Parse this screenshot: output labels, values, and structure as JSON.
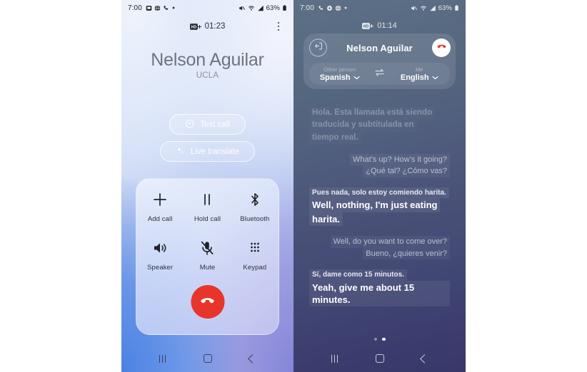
{
  "left_phone": {
    "status_bar": {
      "time": "7:00",
      "left_icons": [
        "sim-card-icon",
        "globe-icon",
        "phone-icon",
        "dot-icon"
      ],
      "right_icons": [
        "mute-slash-icon",
        "wifi-icon",
        "signal-bars-icon"
      ],
      "battery": "63%"
    },
    "call_info": {
      "hd_badge": "HD+",
      "duration": "01:23"
    },
    "overflow_menu": "more-options",
    "caller": {
      "name": "Nelson Aguilar",
      "subtitle": "UCLA"
    },
    "actions": [
      {
        "label": "Text call",
        "icon": "text-call-icon"
      },
      {
        "label": "Live translate",
        "icon": "sparkle-icon"
      }
    ],
    "controls": [
      {
        "label": "Add call",
        "icon": "plus-icon"
      },
      {
        "label": "Hold call",
        "icon": "pause-icon"
      },
      {
        "label": "Bluetooth",
        "icon": "bluetooth-icon"
      },
      {
        "label": "Speaker",
        "icon": "speaker-icon"
      },
      {
        "label": "Mute",
        "icon": "mic-muted-icon"
      },
      {
        "label": "Keypad",
        "icon": "keypad-icon"
      }
    ],
    "end_call": {
      "label": "End call",
      "color": "#e8352b"
    },
    "nav": [
      "recents-button",
      "home-button",
      "back-button"
    ]
  },
  "right_phone": {
    "status_bar": {
      "time": "7:00",
      "left_icons": [
        "phone-icon",
        "gear-icon",
        "globe-icon",
        "dot-icon"
      ],
      "right_icons": [
        "mute-slash-icon",
        "wifi-icon",
        "signal-bars-icon"
      ],
      "battery": "63%"
    },
    "call_info": {
      "hd_badge": "HD+",
      "duration": "01:14"
    },
    "header": {
      "exit_icon": "exit-icon",
      "name": "Nelson Aguilar",
      "end_call_icon": "end-call-icon"
    },
    "languages": {
      "other": {
        "caption": "Other person",
        "value": "Spanish"
      },
      "swap_icon": "swap-languages-icon",
      "me": {
        "caption": "Me",
        "value": "English"
      }
    },
    "transcript": [
      {
        "speaker": "them",
        "style": "faded",
        "source": "Hola. Esta llamada está siendo",
        "source_line2": "traducida y subtitulada en",
        "source_line3": "tiempo real."
      },
      {
        "speaker": "me",
        "style": "faded2",
        "source": "What's up? How's it going?",
        "translation": "¿Qué tal? ¿Cómo vas?"
      },
      {
        "speaker": "them",
        "style": "normal",
        "source": "Pues nada, solo estoy comiendo harita.",
        "translation": "Well, nothing, I'm just eating",
        "translation_line2": "harita."
      },
      {
        "speaker": "me",
        "style": "faded2",
        "source": "Well, do you want to come over?",
        "translation": "Bueno, ¿quieres venir?"
      },
      {
        "speaker": "them",
        "style": "normal",
        "source": "Sí, dame como 15 minutos.",
        "translation": "Yeah, give me about 15 minutes."
      }
    ],
    "page_dots": {
      "count": 2,
      "active_index": 1
    },
    "nav": [
      "recents-button",
      "home-button",
      "back-button"
    ]
  }
}
